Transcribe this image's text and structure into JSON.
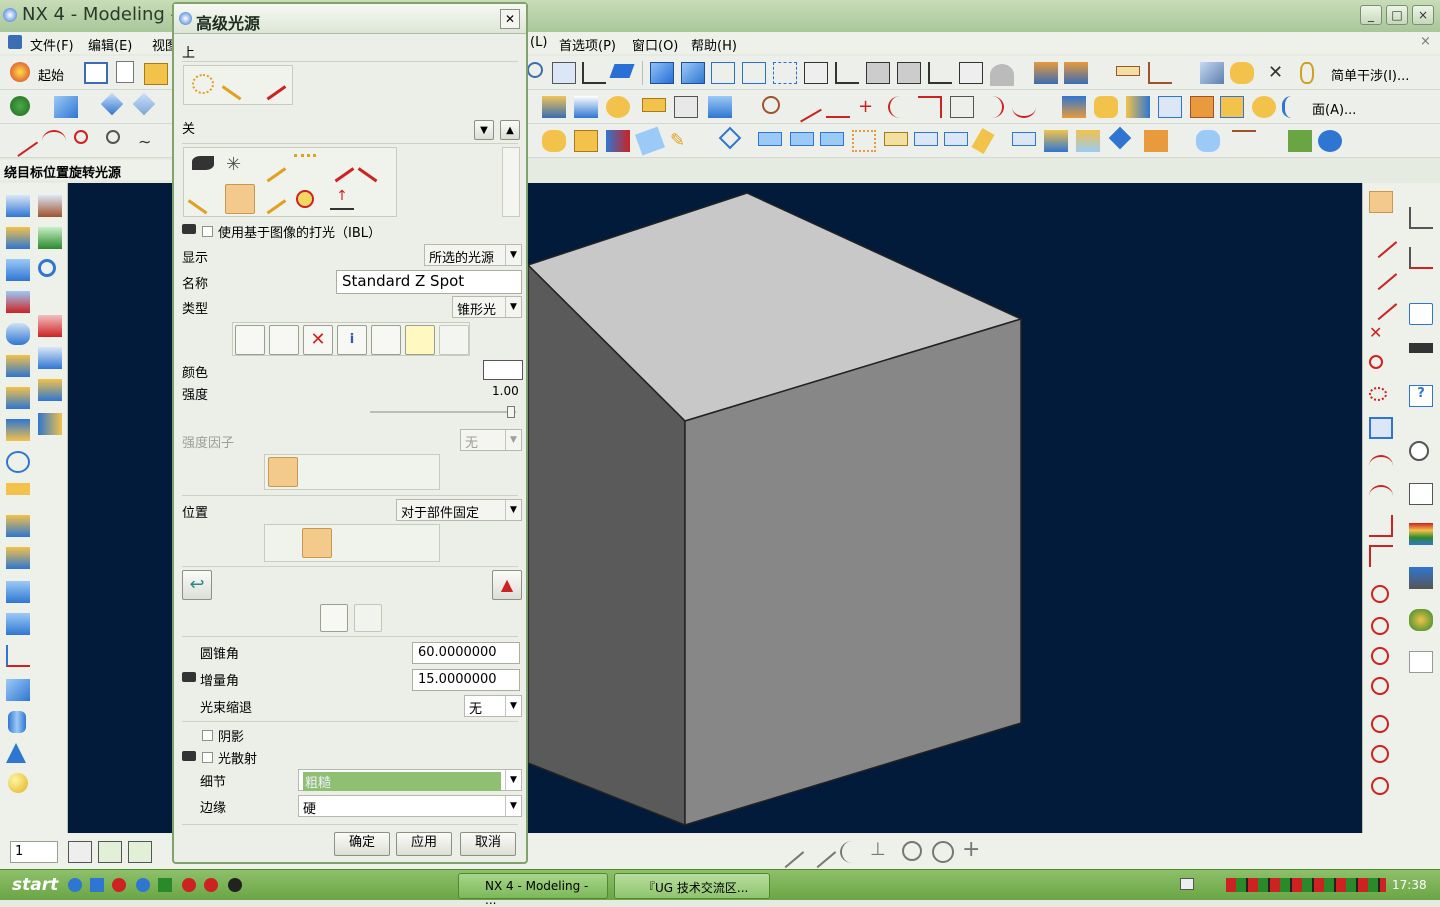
{
  "app": {
    "title": "NX 4 - Modeling -",
    "window_buttons": [
      "_",
      "□",
      "×"
    ]
  },
  "menu": {
    "file": "文件(F)",
    "edit": "编辑(E)",
    "view": "视图",
    "partial_L": "(L)",
    "prefs": "首选项(P)",
    "window": "窗口(O)",
    "help": "帮助(H)"
  },
  "toolbar": {
    "start_label": "起始",
    "right_label_1": "简单干涉(I)...",
    "right_label_2": "面(A)..."
  },
  "status": {
    "hint": "绕目标位置旋转光源"
  },
  "dialog": {
    "title": "高级光源",
    "on_label": "上",
    "off_label": "关",
    "ibl_label": "使用基于图像的打光（IBL）",
    "display_label": "显示",
    "display_value": "所选的光源",
    "name_label": "名称",
    "name_value": "Standard Z Spot",
    "type_label": "类型",
    "type_value": "锥形光",
    "color_label": "颜色",
    "intensity_label": "强度",
    "intensity_value": "1.00",
    "intensity_factor_label": "强度因子",
    "intensity_factor_value": "无",
    "position_label": "位置",
    "position_value": "对于部件固定",
    "cone_angle_label": "圆锥角",
    "cone_angle_value": "60.0000000",
    "delta_angle_label": "增量角",
    "delta_angle_value": "15.0000000",
    "beam_falloff_label": "光束缩退",
    "beam_falloff_value": "无",
    "shadow_label": "阴影",
    "scatter_label": "光散射",
    "detail_label": "细节",
    "detail_value": "粗糙",
    "edge_label": "边缘",
    "edge_value": "硬",
    "ok": "确定",
    "apply": "应用",
    "cancel": "取消"
  },
  "bottom": {
    "layer_value": "1"
  },
  "taskbar": {
    "start": "start",
    "task1": "NX 4 - Modeling - ...",
    "task2": "『UG 技术交流区...",
    "clock": "17:38"
  },
  "colors": {
    "viewport": "#021b3a",
    "cube_top": "#c8c8c8",
    "cube_left": "#5a5a5a",
    "cube_right": "#878787",
    "accent_green": "#7fa36b"
  }
}
